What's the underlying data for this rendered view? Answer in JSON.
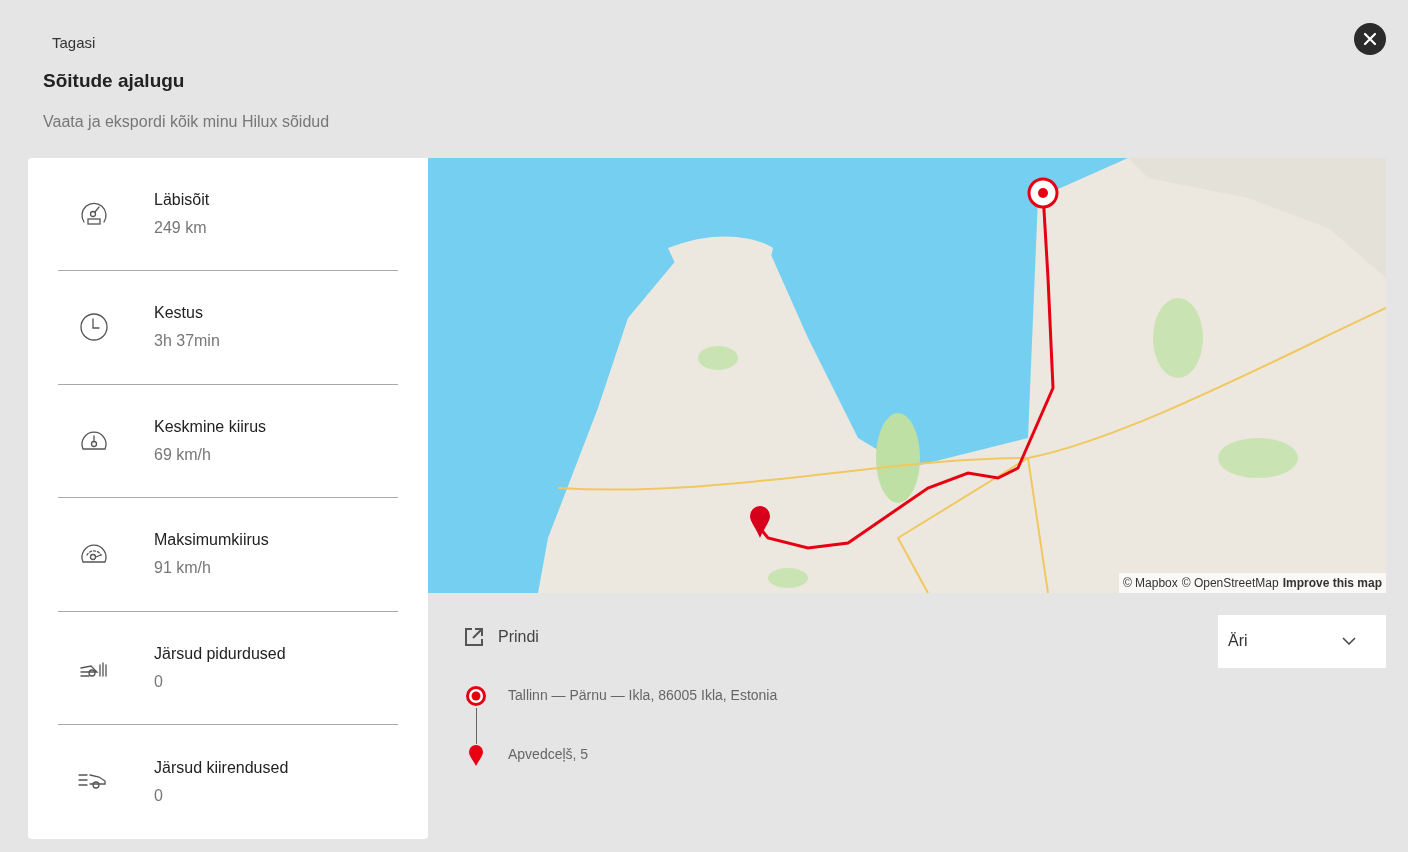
{
  "back_link": "Tagasi",
  "title": "Sõitude ajalugu",
  "subtitle": "Vaata ja ekspordi kõik minu Hilux sõidud",
  "stats": [
    {
      "kind": "odometer",
      "label": "Läbisõit",
      "value": "249 km"
    },
    {
      "kind": "clock",
      "label": "Kestus",
      "value": "3h 37min"
    },
    {
      "kind": "speed",
      "label": "Keskmine kiirus",
      "value": "69 km/h"
    },
    {
      "kind": "maxspeed",
      "label": "Maksimumkiirus",
      "value": "91 km/h"
    },
    {
      "kind": "braking",
      "label": "Järsud pidurdused",
      "value": "0"
    },
    {
      "kind": "acceleration",
      "label": "Järsud kiirendused",
      "value": "0"
    }
  ],
  "map": {
    "attribution": [
      "© Mapbox",
      "© OpenStreetMap",
      "Improve this map"
    ]
  },
  "print_button": "Prindi",
  "trip_type": {
    "value": "Äri"
  },
  "waypoints": [
    {
      "kind": "start",
      "label": "Tallinn — Pärnu — Ikla, 86005 Ikla, Estonia"
    },
    {
      "kind": "end",
      "label": "Apvedceļš, 5"
    }
  ]
}
